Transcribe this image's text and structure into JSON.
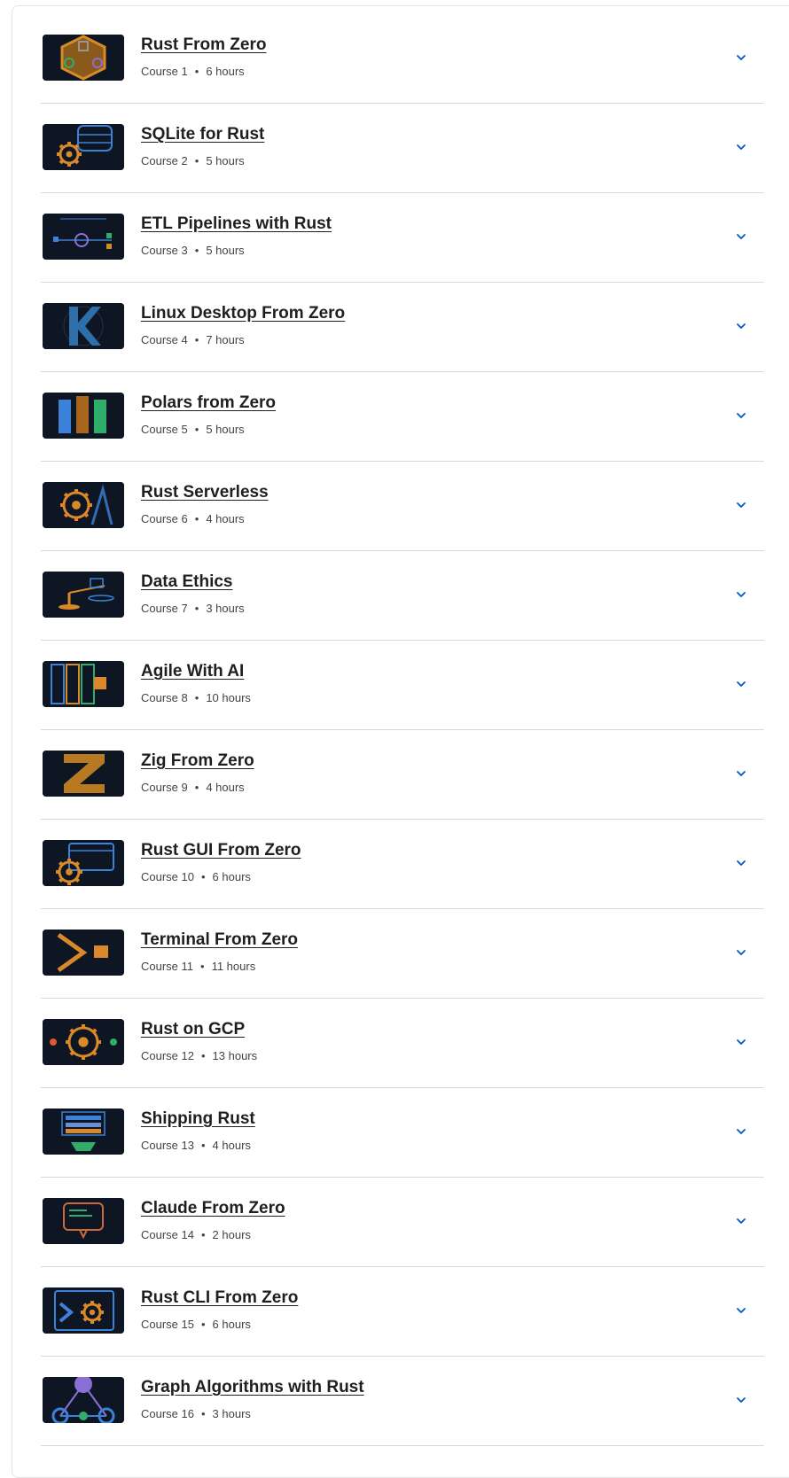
{
  "courses": [
    {
      "title": "Rust From Zero",
      "course": "Course 1",
      "duration": "6 hours",
      "thumb": "hexagon-gear"
    },
    {
      "title": "SQLite for Rust",
      "course": "Course 2",
      "duration": "5 hours",
      "thumb": "database-gear"
    },
    {
      "title": "ETL Pipelines with Rust",
      "course": "Course 3",
      "duration": "5 hours",
      "thumb": "pipeline"
    },
    {
      "title": "Linux Desktop From Zero",
      "course": "Course 4",
      "duration": "7 hours",
      "thumb": "letter-k"
    },
    {
      "title": "Polars from Zero",
      "course": "Course 5",
      "duration": "5 hours",
      "thumb": "columns"
    },
    {
      "title": "Rust Serverless",
      "course": "Course 6",
      "duration": "4 hours",
      "thumb": "gear-lambda"
    },
    {
      "title": "Data Ethics",
      "course": "Course 7",
      "duration": "3 hours",
      "thumb": "balance-scale"
    },
    {
      "title": "Agile With AI",
      "course": "Course 8",
      "duration": "10 hours",
      "thumb": "kanban-board"
    },
    {
      "title": "Zig From Zero",
      "course": "Course 9",
      "duration": "4 hours",
      "thumb": "zig-bolt"
    },
    {
      "title": "Rust GUI From Zero",
      "course": "Course 10",
      "duration": "6 hours",
      "thumb": "window-gear"
    },
    {
      "title": "Terminal From Zero",
      "course": "Course 11",
      "duration": "11 hours",
      "thumb": "terminal-prompt"
    },
    {
      "title": "Rust on GCP",
      "course": "Course 12",
      "duration": "13 hours",
      "thumb": "gear-nodes"
    },
    {
      "title": "Shipping Rust",
      "course": "Course 13",
      "duration": "4 hours",
      "thumb": "stack-package"
    },
    {
      "title": "Claude From Zero",
      "course": "Course 14",
      "duration": "2 hours",
      "thumb": "chat-bubble"
    },
    {
      "title": "Rust CLI From Zero",
      "course": "Course 15",
      "duration": "6 hours",
      "thumb": "cli-window-gear"
    },
    {
      "title": "Graph Algorithms with Rust",
      "course": "Course 16",
      "duration": "3 hours",
      "thumb": "graph-nodes"
    }
  ],
  "separator": "•",
  "expand_icon": "chevron-down-icon",
  "colors": {
    "title": "#1f1f1f",
    "meta": "#444444",
    "divider": "#d9d9d9",
    "chevron": "#0056d2",
    "thumb_bg": "#0f1623",
    "orange": "#d9892a",
    "blue": "#3b82d8",
    "green": "#2fae6a",
    "purple": "#8a70d6"
  }
}
